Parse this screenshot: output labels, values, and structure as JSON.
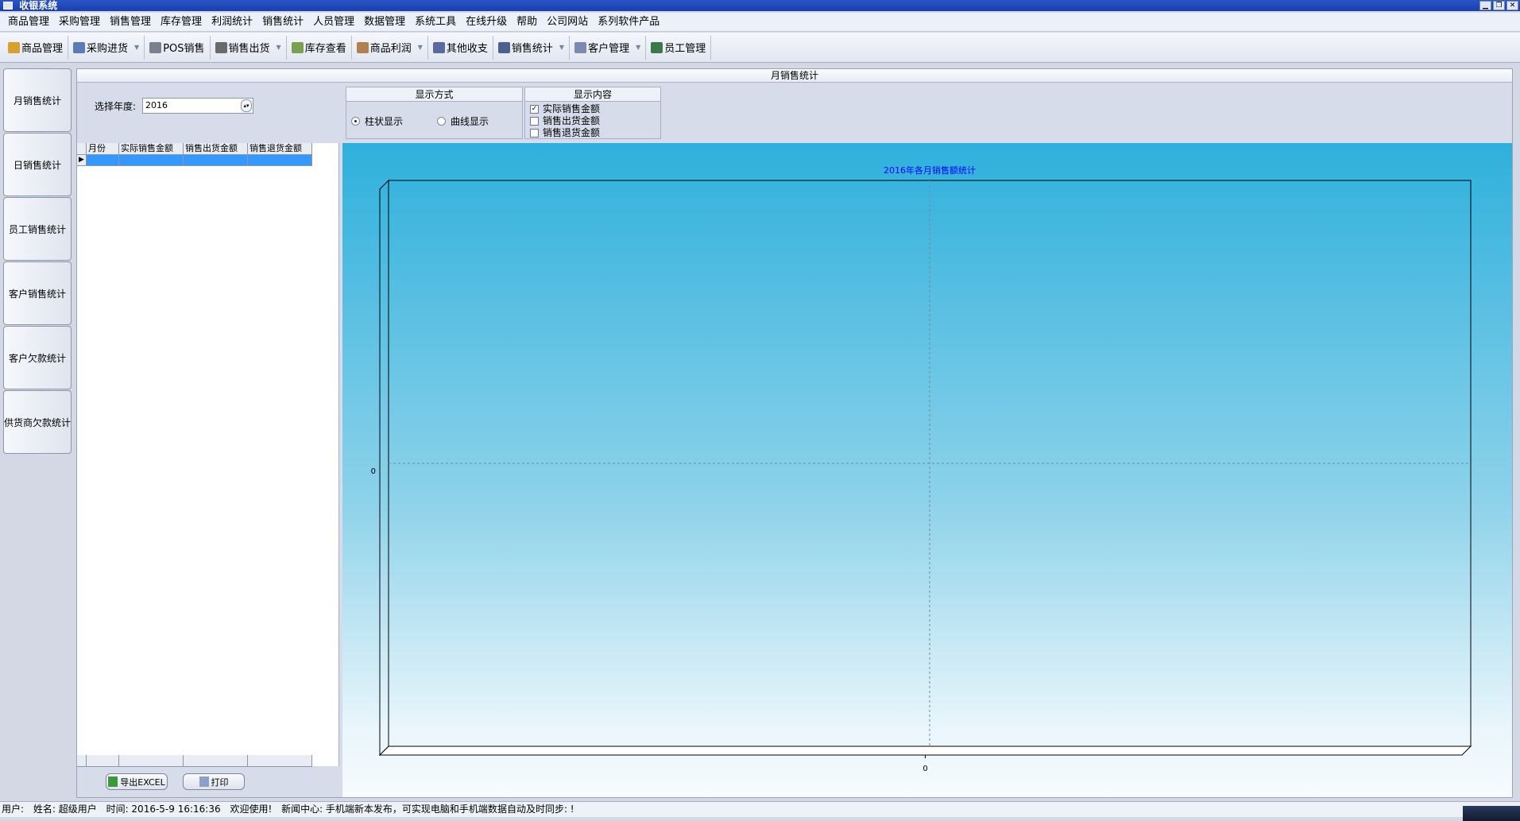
{
  "window": {
    "title": "收银系统"
  },
  "menu": [
    "商品管理",
    "采购管理",
    "销售管理",
    "库存管理",
    "利润统计",
    "销售统计",
    "人员管理",
    "数据管理",
    "系统工具",
    "在线升级",
    "帮助",
    "公司网站",
    "系列软件产品"
  ],
  "toolbar": [
    {
      "label": "商品管理",
      "icon": "box-icon",
      "color": "#d8a030",
      "dropdown": false
    },
    {
      "label": "采购进货",
      "icon": "purchase-icon",
      "color": "#5a7ab8",
      "dropdown": true
    },
    {
      "label": "POS销售",
      "icon": "scanner-icon",
      "color": "#7a8090",
      "dropdown": false
    },
    {
      "label": "销售出货",
      "icon": "truck-icon",
      "color": "#6a6a6a",
      "dropdown": true
    },
    {
      "label": "库存查看",
      "icon": "warehouse-icon",
      "color": "#7aa050",
      "dropdown": false
    },
    {
      "label": "商品利润",
      "icon": "money-icon",
      "color": "#b08050",
      "dropdown": true
    },
    {
      "label": "其他收支",
      "icon": "ledger-icon",
      "color": "#5a6aa0",
      "dropdown": false
    },
    {
      "label": "销售统计",
      "icon": "chart-icon",
      "color": "#4a6090",
      "dropdown": true
    },
    {
      "label": "客户管理",
      "icon": "customer-icon",
      "color": "#7a8ab0",
      "dropdown": true
    },
    {
      "label": "员工管理",
      "icon": "staff-icon",
      "color": "#3a7a4a",
      "dropdown": false
    }
  ],
  "sidebar": [
    "月销售统计",
    "日销售统计",
    "员工销售统计",
    "客户销售统计",
    "客户欠款统计",
    "供货商欠款统计"
  ],
  "panel": {
    "title": "月销售统计",
    "year_label": "选择年度:",
    "year_value": "2016",
    "display_mode": {
      "title": "显示方式",
      "options": [
        "柱状显示",
        "曲线显示"
      ],
      "selected": "柱状显示"
    },
    "display_content": {
      "title": "显示内容",
      "items": [
        {
          "label": "实际销售金额",
          "checked": true
        },
        {
          "label": "销售出货金额",
          "checked": false
        },
        {
          "label": "销售退货金额",
          "checked": false
        }
      ]
    }
  },
  "grid": {
    "columns": [
      "月份",
      "实际销售金额",
      "销售出货金额",
      "销售退货金额"
    ]
  },
  "buttons": {
    "export": "导出EXCEL",
    "print": "打印"
  },
  "chart_data": {
    "type": "bar",
    "title": "2016年各月销售额统计",
    "categories": [
      "0"
    ],
    "series": [
      {
        "values": [
          0
        ]
      }
    ],
    "y_ticks": [
      "0"
    ],
    "grid": true,
    "title_color": "#0000ff"
  },
  "status": {
    "user": "用户:",
    "name": "姓名: 超级用户",
    "time": "时间: 2016-5-9 16:16:36",
    "welcome": "欢迎使用!",
    "news": "新闻中心: 手机端新本发布，可实现电脑和手机端数据自动及时同步: !"
  }
}
